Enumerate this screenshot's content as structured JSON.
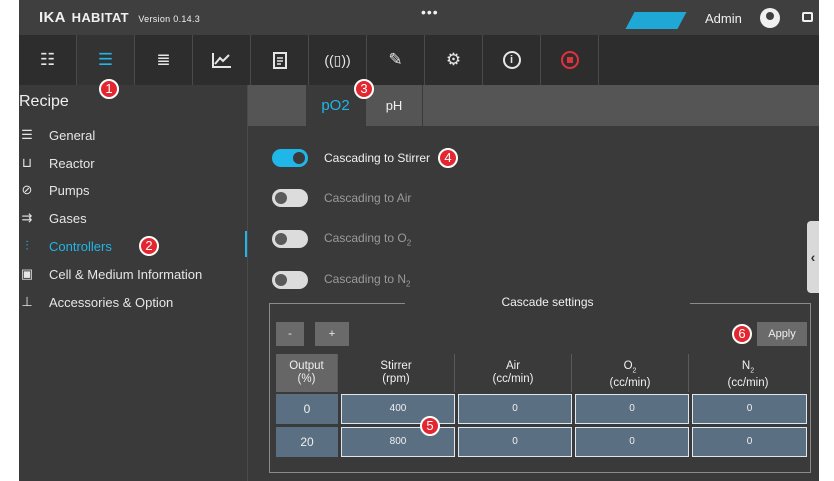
{
  "app": {
    "brand": "IKA",
    "product": "HABITAT",
    "version": "Version 0.14.3",
    "menu_dots": "•••",
    "user": "Admin",
    "colors": {
      "accent": "#1fb6e8",
      "badge": "#e3262f",
      "stop": "#e0323c",
      "table_cell": "#5a7082"
    }
  },
  "toolbar": {
    "buttons": [
      {
        "name": "overview",
        "icon": "overview-icon"
      },
      {
        "name": "recipe",
        "icon": "sliders-icon",
        "active": true
      },
      {
        "name": "list",
        "icon": "list-icon"
      },
      {
        "name": "trend",
        "icon": "chart-icon"
      },
      {
        "name": "report",
        "icon": "clipboard-icon"
      },
      {
        "name": "vibration",
        "icon": "vibration-icon"
      },
      {
        "name": "tools",
        "icon": "wrench-icon"
      },
      {
        "name": "settings",
        "icon": "gear-icon"
      },
      {
        "name": "info",
        "icon": "info-icon"
      },
      {
        "name": "stop",
        "icon": "stop-icon"
      }
    ]
  },
  "badges": {
    "b1": "1",
    "b2": "2",
    "b3": "3",
    "b4": "4",
    "b5": "5",
    "b6": "6"
  },
  "sidebar": {
    "title": "Recipe",
    "items": [
      {
        "label": "General",
        "icon": "general-icon"
      },
      {
        "label": "Reactor",
        "icon": "reactor-icon"
      },
      {
        "label": "Pumps",
        "icon": "pump-icon"
      },
      {
        "label": "Gases",
        "icon": "gas-icon"
      },
      {
        "label": "Controllers",
        "icon": "controllers-icon",
        "active": true
      },
      {
        "label": "Cell & Medium Information",
        "icon": "cell-icon"
      },
      {
        "label": "Accessories & Option",
        "icon": "accessories-icon"
      }
    ]
  },
  "tabs": [
    {
      "label": "pO2",
      "active": true
    },
    {
      "label": "pH",
      "active": false
    }
  ],
  "cascades": [
    {
      "label": "Cascading to Stirrer",
      "on": true
    },
    {
      "label": "Cascading to Air",
      "on": false
    },
    {
      "label": "Cascading to O",
      "sub": "2",
      "on": false
    },
    {
      "label": "Cascading to N",
      "sub": "2",
      "on": false
    }
  ],
  "cascade_settings": {
    "title": "Cascade settings",
    "minus": "-",
    "plus": "+",
    "apply": "Apply",
    "headers": [
      {
        "l1": "Output",
        "l2": "(%)"
      },
      {
        "l1": "Stirrer",
        "l2": "(rpm)"
      },
      {
        "l1": "Air",
        "l2": "(cc/min)"
      },
      {
        "l1": "O",
        "sub": "2",
        "l2": "(cc/min)"
      },
      {
        "l1": "N",
        "sub": "2",
        "l2": "(cc/min)"
      }
    ],
    "rows": [
      [
        "0",
        "400",
        "0",
        "0",
        "0"
      ],
      [
        "20",
        "800",
        "0",
        "0",
        "0"
      ]
    ]
  }
}
